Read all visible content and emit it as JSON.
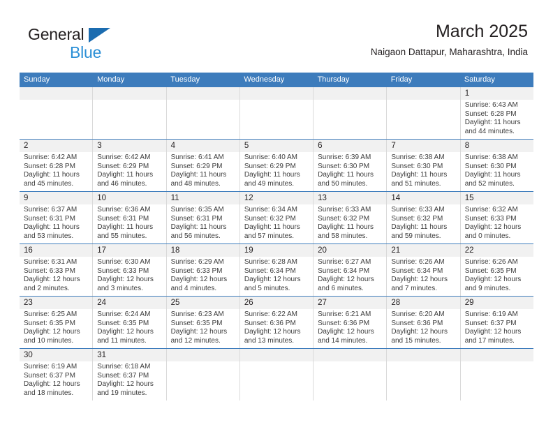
{
  "logo": {
    "word_top": "General",
    "word_bottom": "Blue",
    "triangle_color": "#1b6cb0",
    "blue_text_color": "#2b8fd6"
  },
  "header": {
    "title": "March 2025",
    "subtitle": "Naigaon Dattapur, Maharashtra, India"
  },
  "theme": {
    "header_blue": "#3d7cbc",
    "day_strip_gray": "#f1f1f1",
    "grid_line": "#d9d9d9",
    "text": "#231f20"
  },
  "calendar": {
    "weekday_headers": [
      "Sunday",
      "Monday",
      "Tuesday",
      "Wednesday",
      "Thursday",
      "Friday",
      "Saturday"
    ],
    "labels": {
      "sunrise": "Sunrise:",
      "sunset": "Sunset:",
      "daylight": "Daylight:"
    },
    "weeks": [
      [
        {
          "empty": true
        },
        {
          "empty": true
        },
        {
          "empty": true
        },
        {
          "empty": true
        },
        {
          "empty": true
        },
        {
          "empty": true
        },
        {
          "day": "1",
          "sunrise": "Sunrise: 6:43 AM",
          "sunset": "Sunset: 6:28 PM",
          "daylight_1": "Daylight: 11 hours",
          "daylight_2": "and 44 minutes."
        }
      ],
      [
        {
          "day": "2",
          "sunrise": "Sunrise: 6:42 AM",
          "sunset": "Sunset: 6:28 PM",
          "daylight_1": "Daylight: 11 hours",
          "daylight_2": "and 45 minutes."
        },
        {
          "day": "3",
          "sunrise": "Sunrise: 6:42 AM",
          "sunset": "Sunset: 6:29 PM",
          "daylight_1": "Daylight: 11 hours",
          "daylight_2": "and 46 minutes."
        },
        {
          "day": "4",
          "sunrise": "Sunrise: 6:41 AM",
          "sunset": "Sunset: 6:29 PM",
          "daylight_1": "Daylight: 11 hours",
          "daylight_2": "and 48 minutes."
        },
        {
          "day": "5",
          "sunrise": "Sunrise: 6:40 AM",
          "sunset": "Sunset: 6:29 PM",
          "daylight_1": "Daylight: 11 hours",
          "daylight_2": "and 49 minutes."
        },
        {
          "day": "6",
          "sunrise": "Sunrise: 6:39 AM",
          "sunset": "Sunset: 6:30 PM",
          "daylight_1": "Daylight: 11 hours",
          "daylight_2": "and 50 minutes."
        },
        {
          "day": "7",
          "sunrise": "Sunrise: 6:38 AM",
          "sunset": "Sunset: 6:30 PM",
          "daylight_1": "Daylight: 11 hours",
          "daylight_2": "and 51 minutes."
        },
        {
          "day": "8",
          "sunrise": "Sunrise: 6:38 AM",
          "sunset": "Sunset: 6:30 PM",
          "daylight_1": "Daylight: 11 hours",
          "daylight_2": "and 52 minutes."
        }
      ],
      [
        {
          "day": "9",
          "sunrise": "Sunrise: 6:37 AM",
          "sunset": "Sunset: 6:31 PM",
          "daylight_1": "Daylight: 11 hours",
          "daylight_2": "and 53 minutes."
        },
        {
          "day": "10",
          "sunrise": "Sunrise: 6:36 AM",
          "sunset": "Sunset: 6:31 PM",
          "daylight_1": "Daylight: 11 hours",
          "daylight_2": "and 55 minutes."
        },
        {
          "day": "11",
          "sunrise": "Sunrise: 6:35 AM",
          "sunset": "Sunset: 6:31 PM",
          "daylight_1": "Daylight: 11 hours",
          "daylight_2": "and 56 minutes."
        },
        {
          "day": "12",
          "sunrise": "Sunrise: 6:34 AM",
          "sunset": "Sunset: 6:32 PM",
          "daylight_1": "Daylight: 11 hours",
          "daylight_2": "and 57 minutes."
        },
        {
          "day": "13",
          "sunrise": "Sunrise: 6:33 AM",
          "sunset": "Sunset: 6:32 PM",
          "daylight_1": "Daylight: 11 hours",
          "daylight_2": "and 58 minutes."
        },
        {
          "day": "14",
          "sunrise": "Sunrise: 6:33 AM",
          "sunset": "Sunset: 6:32 PM",
          "daylight_1": "Daylight: 11 hours",
          "daylight_2": "and 59 minutes."
        },
        {
          "day": "15",
          "sunrise": "Sunrise: 6:32 AM",
          "sunset": "Sunset: 6:33 PM",
          "daylight_1": "Daylight: 12 hours",
          "daylight_2": "and 0 minutes."
        }
      ],
      [
        {
          "day": "16",
          "sunrise": "Sunrise: 6:31 AM",
          "sunset": "Sunset: 6:33 PM",
          "daylight_1": "Daylight: 12 hours",
          "daylight_2": "and 2 minutes."
        },
        {
          "day": "17",
          "sunrise": "Sunrise: 6:30 AM",
          "sunset": "Sunset: 6:33 PM",
          "daylight_1": "Daylight: 12 hours",
          "daylight_2": "and 3 minutes."
        },
        {
          "day": "18",
          "sunrise": "Sunrise: 6:29 AM",
          "sunset": "Sunset: 6:33 PM",
          "daylight_1": "Daylight: 12 hours",
          "daylight_2": "and 4 minutes."
        },
        {
          "day": "19",
          "sunrise": "Sunrise: 6:28 AM",
          "sunset": "Sunset: 6:34 PM",
          "daylight_1": "Daylight: 12 hours",
          "daylight_2": "and 5 minutes."
        },
        {
          "day": "20",
          "sunrise": "Sunrise: 6:27 AM",
          "sunset": "Sunset: 6:34 PM",
          "daylight_1": "Daylight: 12 hours",
          "daylight_2": "and 6 minutes."
        },
        {
          "day": "21",
          "sunrise": "Sunrise: 6:26 AM",
          "sunset": "Sunset: 6:34 PM",
          "daylight_1": "Daylight: 12 hours",
          "daylight_2": "and 7 minutes."
        },
        {
          "day": "22",
          "sunrise": "Sunrise: 6:26 AM",
          "sunset": "Sunset: 6:35 PM",
          "daylight_1": "Daylight: 12 hours",
          "daylight_2": "and 9 minutes."
        }
      ],
      [
        {
          "day": "23",
          "sunrise": "Sunrise: 6:25 AM",
          "sunset": "Sunset: 6:35 PM",
          "daylight_1": "Daylight: 12 hours",
          "daylight_2": "and 10 minutes."
        },
        {
          "day": "24",
          "sunrise": "Sunrise: 6:24 AM",
          "sunset": "Sunset: 6:35 PM",
          "daylight_1": "Daylight: 12 hours",
          "daylight_2": "and 11 minutes."
        },
        {
          "day": "25",
          "sunrise": "Sunrise: 6:23 AM",
          "sunset": "Sunset: 6:35 PM",
          "daylight_1": "Daylight: 12 hours",
          "daylight_2": "and 12 minutes."
        },
        {
          "day": "26",
          "sunrise": "Sunrise: 6:22 AM",
          "sunset": "Sunset: 6:36 PM",
          "daylight_1": "Daylight: 12 hours",
          "daylight_2": "and 13 minutes."
        },
        {
          "day": "27",
          "sunrise": "Sunrise: 6:21 AM",
          "sunset": "Sunset: 6:36 PM",
          "daylight_1": "Daylight: 12 hours",
          "daylight_2": "and 14 minutes."
        },
        {
          "day": "28",
          "sunrise": "Sunrise: 6:20 AM",
          "sunset": "Sunset: 6:36 PM",
          "daylight_1": "Daylight: 12 hours",
          "daylight_2": "and 15 minutes."
        },
        {
          "day": "29",
          "sunrise": "Sunrise: 6:19 AM",
          "sunset": "Sunset: 6:37 PM",
          "daylight_1": "Daylight: 12 hours",
          "daylight_2": "and 17 minutes."
        }
      ],
      [
        {
          "day": "30",
          "sunrise": "Sunrise: 6:19 AM",
          "sunset": "Sunset: 6:37 PM",
          "daylight_1": "Daylight: 12 hours",
          "daylight_2": "and 18 minutes."
        },
        {
          "day": "31",
          "sunrise": "Sunrise: 6:18 AM",
          "sunset": "Sunset: 6:37 PM",
          "daylight_1": "Daylight: 12 hours",
          "daylight_2": "and 19 minutes."
        },
        {
          "empty": true
        },
        {
          "empty": true
        },
        {
          "empty": true
        },
        {
          "empty": true
        },
        {
          "empty": true
        }
      ]
    ]
  }
}
